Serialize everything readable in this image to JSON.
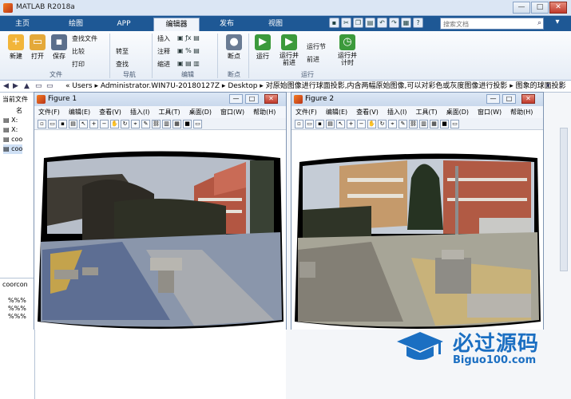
{
  "window": {
    "title": "MATLAB R2018a",
    "min": "—",
    "max": "□",
    "close": "✕"
  },
  "tabs": [
    "主页",
    "绘图",
    "APP",
    "编辑器",
    "发布",
    "视图"
  ],
  "active_tab": 3,
  "search": {
    "placeholder": "搜索文档",
    "help": "?"
  },
  "ribbon": {
    "file": {
      "new": "新建",
      "open": "打开",
      "save": "保存",
      "find_files": "查找文件",
      "compare": "比较",
      "print": "打印",
      "group": "文件"
    },
    "nav": {
      "goto": "转至",
      "find": "查找",
      "group": "导航"
    },
    "edit": {
      "insert": "插入",
      "comment": "注释",
      "indent": "缩进",
      "group": "编辑"
    },
    "breakpoints": {
      "label": "断点",
      "group": "断点"
    },
    "run": {
      "run": "运行",
      "run_advance": "运行并\n前进",
      "run_section": "运行节",
      "advance": "前进",
      "run_time": "运行并\n计时",
      "group": "运行"
    }
  },
  "path": {
    "segments": [
      "«",
      "Users",
      "Administrator.WIN7U-20180127Z",
      "Desktop",
      "对原始图像进行球面投影,内含两幅原始图像,可以对彩色或灰度图像进行投影",
      "图象的球面投影"
    ]
  },
  "left": {
    "header": "当前文件",
    "col": "名",
    "files": [
      "X:",
      "X:",
      "coo",
      "coo"
    ],
    "panel2": "coorcon",
    "lines": [
      "%%%",
      "%%%",
      "%%%"
    ]
  },
  "figures": [
    {
      "title": "Figure 1",
      "menu": [
        "文件(F)",
        "编辑(E)",
        "查看(V)",
        "插入(I)",
        "工具(T)",
        "桌面(D)",
        "窗口(W)",
        "帮助(H)"
      ]
    },
    {
      "title": "Figure 2",
      "menu": [
        "文件(F)",
        "编辑(E)",
        "查看(V)",
        "插入(I)",
        "工具(T)",
        "桌面(D)",
        "窗口(W)",
        "帮助(H)"
      ]
    }
  ],
  "watermark": {
    "title": "必过源码",
    "url": "Biguo100.com"
  }
}
